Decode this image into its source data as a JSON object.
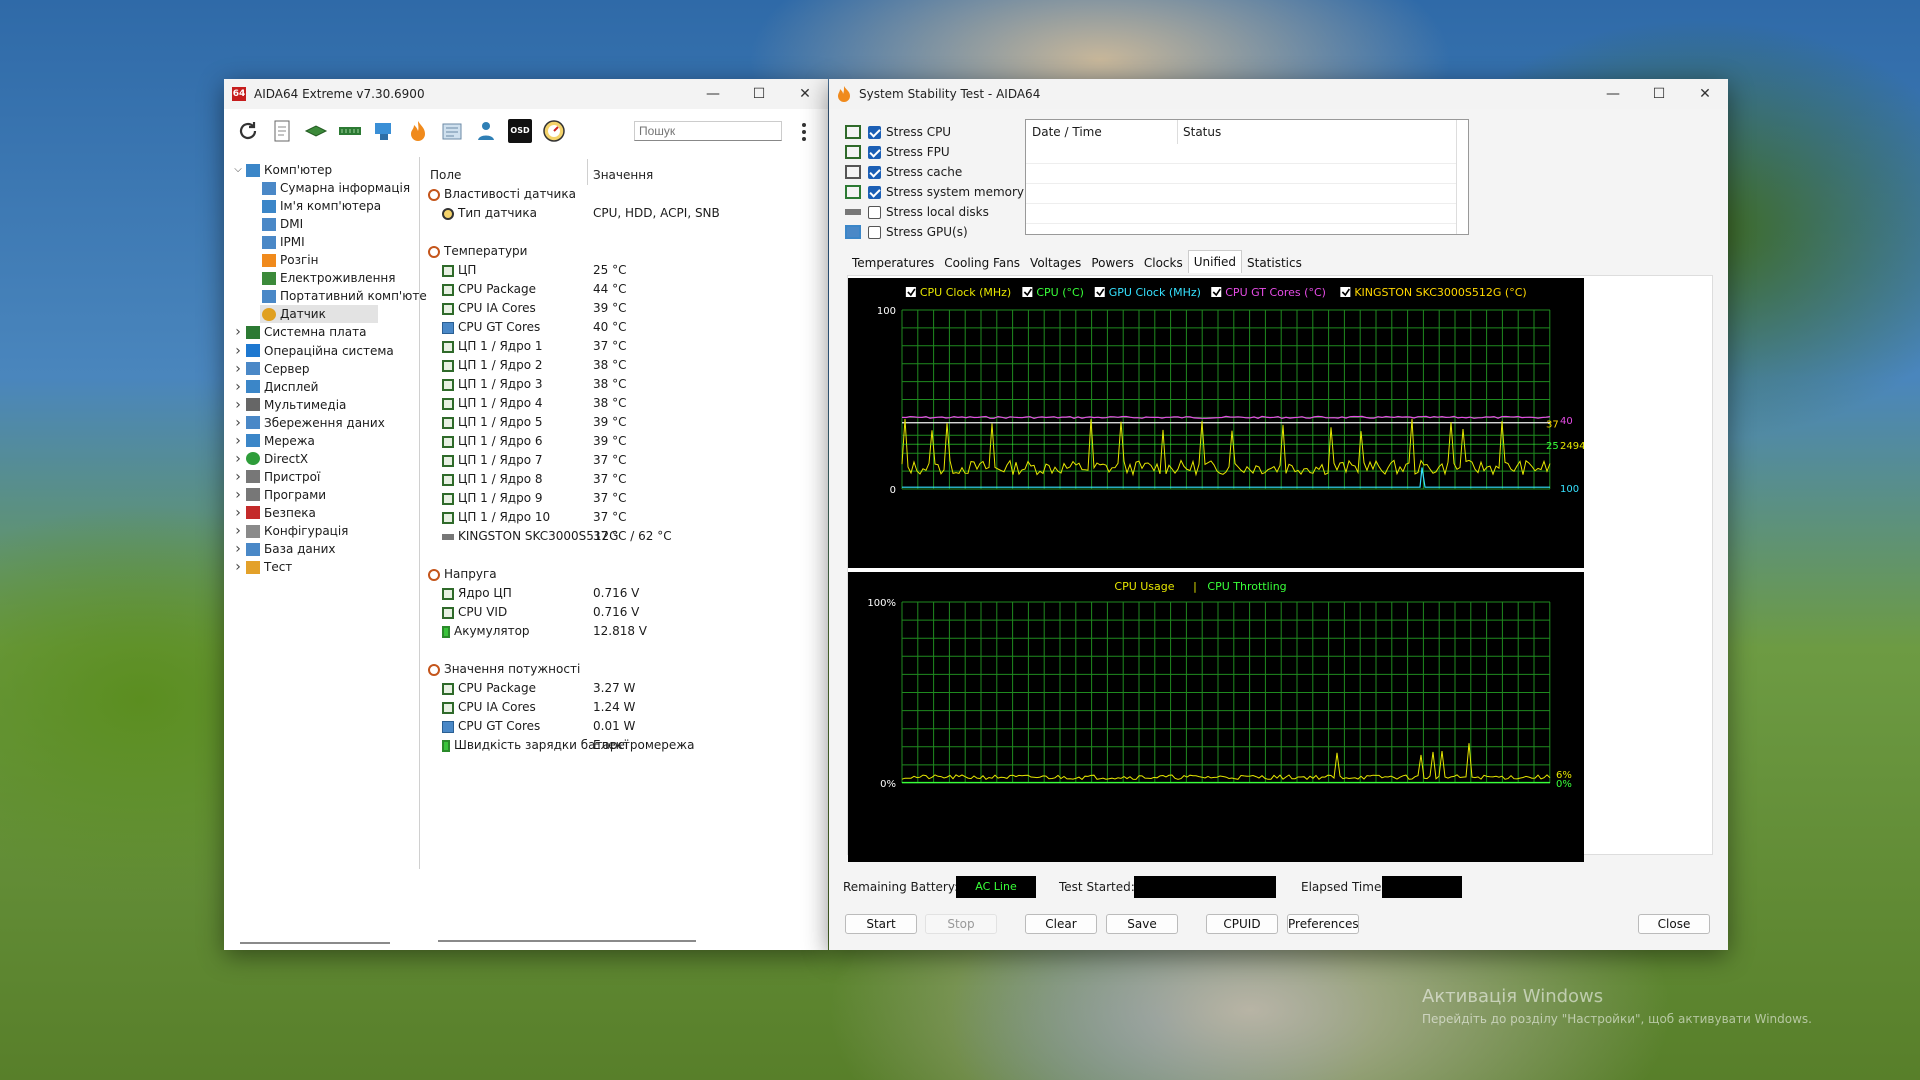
{
  "aida_window": {
    "title": "AIDA64 Extreme v7.30.6900",
    "search_placeholder": "Пошук",
    "toolbar_icons": [
      "refresh-icon",
      "report-icon",
      "motherboard-icon",
      "memory-icon",
      "network-icon",
      "flame-icon",
      "cpuid-icon",
      "benchmark-icon",
      "osd-icon",
      "sensor-gauge-icon"
    ],
    "tree": [
      {
        "label": "Комп'ютер",
        "level": 0,
        "expanded": true,
        "icon": "computer-icon"
      },
      {
        "label": "Сумарна інформація",
        "level": 1,
        "icon": "summary-icon"
      },
      {
        "label": "Ім'я комп'ютера",
        "level": 1,
        "icon": "computer-name-icon"
      },
      {
        "label": "DMI",
        "level": 1,
        "icon": "dmi-icon"
      },
      {
        "label": "IPMI",
        "level": 1,
        "icon": "ipmi-icon"
      },
      {
        "label": "Розгін",
        "level": 1,
        "icon": "overclock-flame-icon"
      },
      {
        "label": "Електроживлення",
        "level": 1,
        "icon": "power-plug-icon"
      },
      {
        "label": "Портативний комп'юте",
        "level": 1,
        "icon": "laptop-icon"
      },
      {
        "label": "Датчик",
        "level": 1,
        "icon": "sensor-gauge-icon",
        "selected": true
      },
      {
        "label": "Системна плата",
        "level": 0,
        "icon": "motherboard-icon"
      },
      {
        "label": "Операційна система",
        "level": 0,
        "icon": "windows-icon"
      },
      {
        "label": "Сервер",
        "level": 0,
        "icon": "server-icon"
      },
      {
        "label": "Дисплей",
        "level": 0,
        "icon": "display-icon"
      },
      {
        "label": "Мультимедіа",
        "level": 0,
        "icon": "speaker-icon"
      },
      {
        "label": "Збереження даних",
        "level": 0,
        "icon": "storage-icon"
      },
      {
        "label": "Мережа",
        "level": 0,
        "icon": "network-icon"
      },
      {
        "label": "DirectX",
        "level": 0,
        "icon": "directx-icon"
      },
      {
        "label": "Пристрої",
        "level": 0,
        "icon": "devices-icon"
      },
      {
        "label": "Програми",
        "level": 0,
        "icon": "programs-icon"
      },
      {
        "label": "Безпека",
        "level": 0,
        "icon": "security-shield-icon"
      },
      {
        "label": "Конфігурація",
        "level": 0,
        "icon": "config-icon"
      },
      {
        "label": "База даних",
        "level": 0,
        "icon": "database-icon"
      },
      {
        "label": "Тест",
        "level": 0,
        "icon": "test-icon"
      }
    ],
    "columns": {
      "field": "Поле",
      "value": "Значення"
    },
    "rows": [
      {
        "type": "group",
        "label": "Властивості датчика"
      },
      {
        "type": "item",
        "label": "Тип датчика",
        "value": "CPU, HDD, ACPI, SNB",
        "icon": "gauge"
      },
      {
        "type": "gap"
      },
      {
        "type": "group",
        "label": "Температури"
      },
      {
        "type": "item",
        "label": "ЦП",
        "value": "25 °C",
        "icon": "chip"
      },
      {
        "type": "item",
        "label": "CPU Package",
        "value": "44 °C",
        "icon": "chip"
      },
      {
        "type": "item",
        "label": "CPU IA Cores",
        "value": "39 °C",
        "icon": "chip"
      },
      {
        "type": "item",
        "label": "CPU GT Cores",
        "value": "40 °C",
        "icon": "monitor"
      },
      {
        "type": "item",
        "label": "ЦП 1 / Ядро 1",
        "value": "37 °C",
        "icon": "chip"
      },
      {
        "type": "item",
        "label": "ЦП 1 / Ядро 2",
        "value": "38 °C",
        "icon": "chip"
      },
      {
        "type": "item",
        "label": "ЦП 1 / Ядро 3",
        "value": "38 °C",
        "icon": "chip"
      },
      {
        "type": "item",
        "label": "ЦП 1 / Ядро 4",
        "value": "38 °C",
        "icon": "chip"
      },
      {
        "type": "item",
        "label": "ЦП 1 / Ядро 5",
        "value": "39 °C",
        "icon": "chip"
      },
      {
        "type": "item",
        "label": "ЦП 1 / Ядро 6",
        "value": "39 °C",
        "icon": "chip"
      },
      {
        "type": "item",
        "label": "ЦП 1 / Ядро 7",
        "value": "37 °C",
        "icon": "chip"
      },
      {
        "type": "item",
        "label": "ЦП 1 / Ядро 8",
        "value": "37 °C",
        "icon": "chip"
      },
      {
        "type": "item",
        "label": "ЦП 1 / Ядро 9",
        "value": "37 °C",
        "icon": "chip"
      },
      {
        "type": "item",
        "label": "ЦП 1 / Ядро 10",
        "value": "37 °C",
        "icon": "chip"
      },
      {
        "type": "item",
        "label": "KINGSTON SKC3000S512G",
        "value": "37 °C / 62 °C",
        "icon": "disk"
      },
      {
        "type": "gap"
      },
      {
        "type": "group",
        "label": "Напруга"
      },
      {
        "type": "item",
        "label": "Ядро ЦП",
        "value": "0.716 V",
        "icon": "chip"
      },
      {
        "type": "item",
        "label": "CPU VID",
        "value": "0.716 V",
        "icon": "chip"
      },
      {
        "type": "item",
        "label": "Акумулятор",
        "value": "12.818 V",
        "icon": "battery"
      },
      {
        "type": "gap"
      },
      {
        "type": "group",
        "label": "Значення потужності"
      },
      {
        "type": "item",
        "label": "CPU Package",
        "value": "3.27 W",
        "icon": "chip"
      },
      {
        "type": "item",
        "label": "CPU IA Cores",
        "value": "1.24 W",
        "icon": "chip"
      },
      {
        "type": "item",
        "label": "CPU GT Cores",
        "value": "0.01 W",
        "icon": "monitor"
      },
      {
        "type": "item",
        "label": "Швидкість зарядки батареї",
        "value": "Електромережа",
        "icon": "battery"
      }
    ]
  },
  "stability_window": {
    "title": "System Stability Test - AIDA64",
    "stress_options": [
      {
        "label": "Stress CPU",
        "checked": true,
        "icon": "cpu-chip-icon"
      },
      {
        "label": "Stress FPU",
        "checked": true,
        "icon": "fpu-icon"
      },
      {
        "label": "Stress cache",
        "checked": true,
        "icon": "cache-icon"
      },
      {
        "label": "Stress system memory",
        "checked": true,
        "icon": "memory-icon"
      },
      {
        "label": "Stress local disks",
        "checked": false,
        "icon": "disk-icon"
      },
      {
        "label": "Stress GPU(s)",
        "checked": false,
        "icon": "gpu-monitor-icon"
      }
    ],
    "log_columns": {
      "datetime": "Date / Time",
      "status": "Status"
    },
    "tabs": [
      "Temperatures",
      "Cooling Fans",
      "Voltages",
      "Powers",
      "Clocks",
      "Unified",
      "Statistics"
    ],
    "active_tab": "Unified",
    "chart1_legend": [
      {
        "label": "CPU Clock (MHz)",
        "color": "#e6e600"
      },
      {
        "label": "CPU (°C)",
        "color": "#39ff39"
      },
      {
        "label": "GPU Clock (MHz)",
        "color": "#36e2ff"
      },
      {
        "label": "CPU GT Cores (°C)",
        "color": "#e64ce6"
      },
      {
        "label": "KINGSTON SKC3000S512G (°C)",
        "color": "#ffd700"
      }
    ],
    "chart1_axis": {
      "top": "100",
      "bottom": "0"
    },
    "chart1_right_labels": [
      {
        "text": "40",
        "color": "#e64ce6"
      },
      {
        "text": "37",
        "color": "#ffd700"
      },
      {
        "text": "25",
        "color": "#39ff39"
      },
      {
        "text": "2494",
        "color": "#e6e600"
      },
      {
        "text": "100",
        "color": "#36e2ff"
      }
    ],
    "chart2_legend": [
      {
        "label": "CPU Usage",
        "color": "#e6e600"
      },
      {
        "label": "|",
        "color": "#e6e600"
      },
      {
        "label": "CPU Throttling",
        "color": "#39ff39"
      }
    ],
    "chart2_axis": {
      "top": "100%",
      "bottom": "0%"
    },
    "chart2_right_labels": [
      {
        "text": "6%",
        "color": "#e6e600"
      },
      {
        "text": "0%",
        "color": "#39ff39"
      }
    ],
    "remaining_battery_label": "Remaining Battery:",
    "remaining_battery_value": "AC Line",
    "test_started_label": "Test Started:",
    "elapsed_time_label": "Elapsed Time:",
    "buttons": {
      "start": "Start",
      "stop": "Stop",
      "clear": "Clear",
      "save": "Save",
      "cpuid": "CPUID",
      "preferences": "Preferences",
      "close": "Close"
    }
  },
  "watermark": {
    "line1": "Активація Windows",
    "line2": "Перейдіть до розділу \"Настройки\", щоб активувати Windows."
  }
}
